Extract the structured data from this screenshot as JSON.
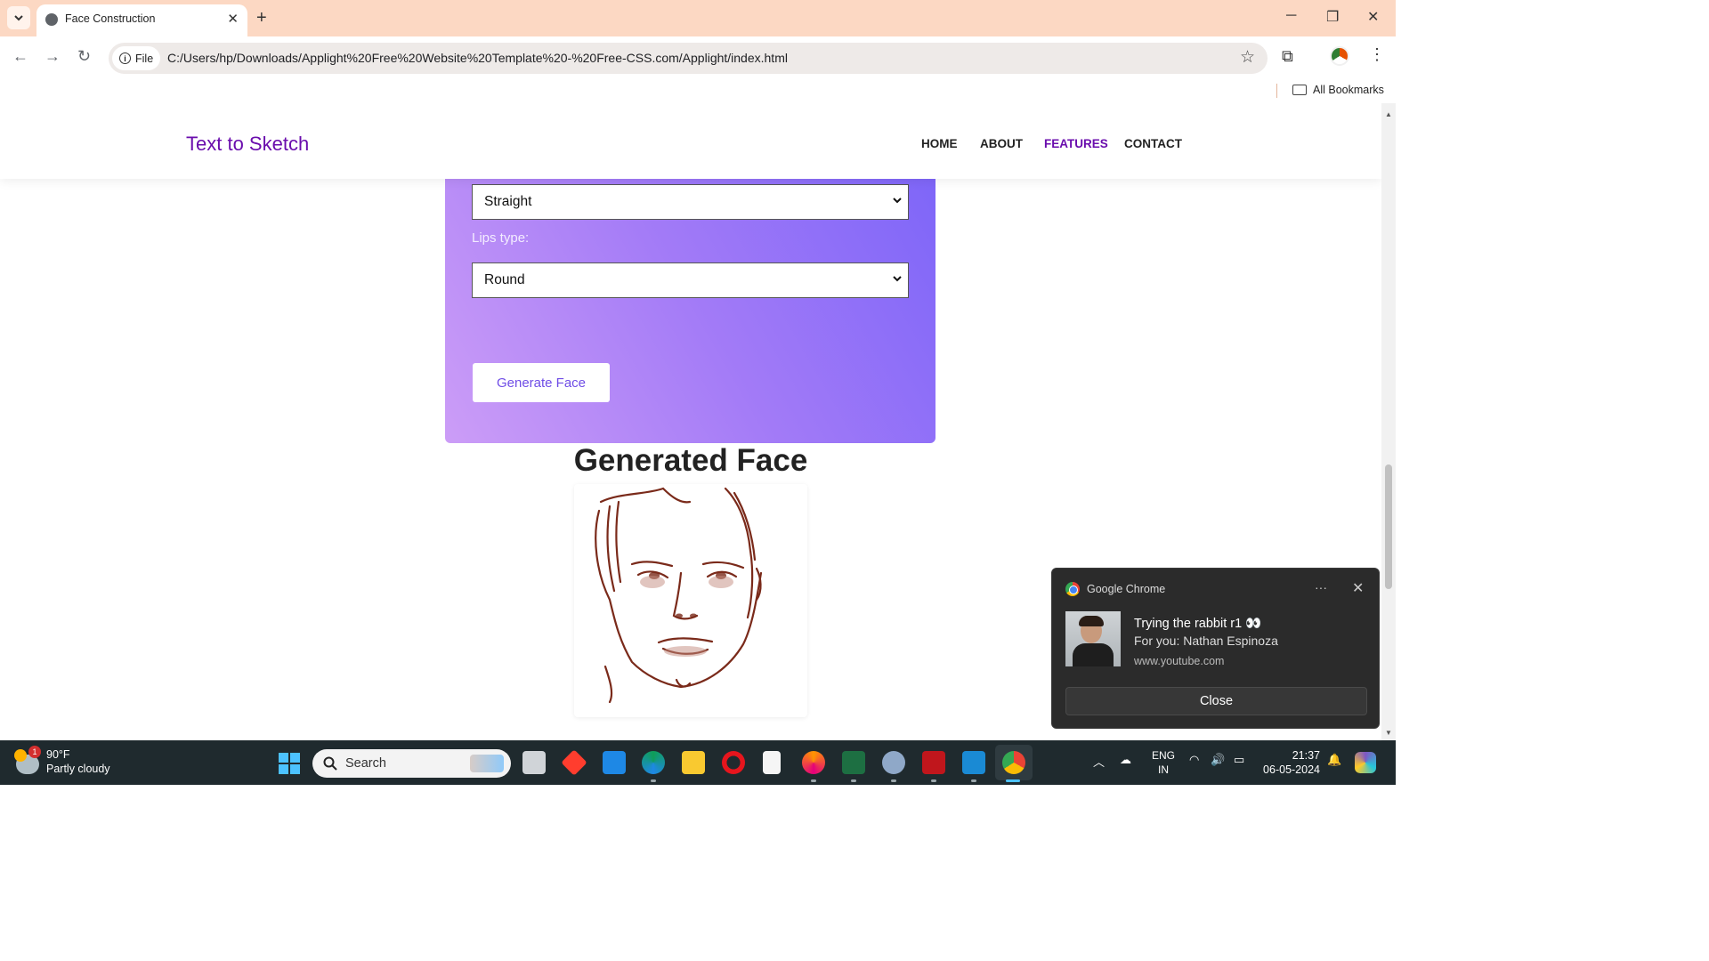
{
  "browser": {
    "tab_title": "Face Construction",
    "tab_close": "✕",
    "new_tab": "+",
    "url_chip": "File",
    "url": "C:/Users/hp/Downloads/Applight%20Free%20Website%20Template%20-%20Free-CSS.com/Applight/index.html",
    "bookmarks_label": "All Bookmarks",
    "icons": [
      "chevron-down-icon",
      "globe-icon",
      "back-icon",
      "forward-icon",
      "reload-icon",
      "info-icon",
      "star-icon",
      "extensions-icon",
      "profile-avatar",
      "kebab-icon",
      "folder-icon"
    ]
  },
  "site": {
    "brand": "Text to Sketch",
    "nav": [
      "HOME",
      "ABOUT",
      "FEATURES",
      "CONTACT"
    ],
    "active_nav": "FEATURES",
    "brand_color": "#6a0dad"
  },
  "form": {
    "nose_select_value": "Straight",
    "lips_label": "Lips type:",
    "lips_select_value": "Round",
    "generate_button": "Generate Face",
    "gradient": [
      "#cc9df7",
      "#7d65f8"
    ]
  },
  "result": {
    "title": "Generated Face"
  },
  "notification": {
    "app": "Google Chrome",
    "title": "Trying the rabbit r1 👀",
    "subtitle": "For you: Nathan Espinoza",
    "source": "www.youtube.com",
    "button": "Close"
  },
  "taskbar": {
    "weather_temp": "90°F",
    "weather_desc": "Partly cloudy",
    "weather_badge": "1",
    "search_placeholder": "Search",
    "lang_line1": "ENG",
    "lang_line2": "IN",
    "time": "21:37",
    "date": "06-05-2024"
  }
}
